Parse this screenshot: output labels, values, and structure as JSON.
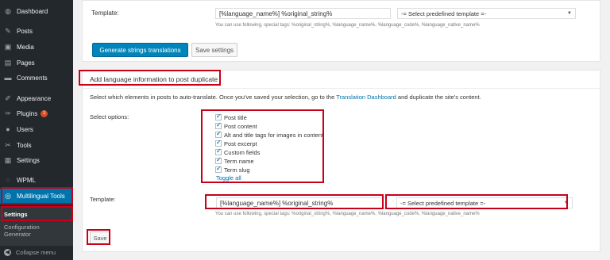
{
  "sidebar": {
    "items": [
      {
        "label": "Dashboard",
        "icon": "dashboard-icon",
        "glyph": "◍"
      },
      {
        "label": "Posts",
        "icon": "pin-icon",
        "glyph": "✎"
      },
      {
        "label": "Media",
        "icon": "media-icon",
        "glyph": "▣"
      },
      {
        "label": "Pages",
        "icon": "pages-icon",
        "glyph": "▤"
      },
      {
        "label": "Comments",
        "icon": "comment-icon",
        "glyph": "▬"
      },
      {
        "label": "Appearance",
        "icon": "brush-icon",
        "glyph": "✐"
      },
      {
        "label": "Plugins",
        "icon": "plugin-icon",
        "glyph": "✑",
        "badge": "1"
      },
      {
        "label": "Users",
        "icon": "users-icon",
        "glyph": "●"
      },
      {
        "label": "Tools",
        "icon": "wrench-icon",
        "glyph": "✂"
      },
      {
        "label": "Settings",
        "icon": "settings-icon",
        "glyph": "▦"
      },
      {
        "label": "WPML",
        "icon": "wpml-icon",
        "glyph": "◌"
      },
      {
        "label": "Multilingual Tools",
        "icon": "multilingual-tools-icon",
        "glyph": "◎"
      }
    ],
    "submenu": {
      "settings": "Settings",
      "config_generator_line1": "Configuration",
      "config_generator_line2": "Generator"
    },
    "collapse": "Collapse menu"
  },
  "top_section": {
    "template_label": "Template:",
    "template_value": "[%language_name%] %original_string%",
    "predefined_select": "-= Select predefined template =-",
    "hint": "You can use following, special tags: %original_string%, %language_name%, %language_code%, %language_native_name%",
    "generate_button": "Generate strings translations",
    "save_settings_button": "Save settings"
  },
  "duplicate_section": {
    "title": "Add language information to post duplicate",
    "description_before": "Select which elements in posts to auto-translate. Once you've saved your selection, go to the ",
    "description_link": "Translation Dashboard",
    "description_after": " and duplicate the site's content.",
    "options_label": "Select options:",
    "options": [
      {
        "label": "Post title",
        "checked": true
      },
      {
        "label": "Post content",
        "checked": true
      },
      {
        "label": "Alt and title tags for images in content",
        "checked": true
      },
      {
        "label": "Post excerpt",
        "checked": true
      },
      {
        "label": "Custom fields",
        "checked": true
      },
      {
        "label": "Term name",
        "checked": true
      },
      {
        "label": "Term slug",
        "checked": true
      }
    ],
    "toggle_all": "Toggle all",
    "template_label": "Template:",
    "template_value": "[%language_name%] %original_string%",
    "predefined_select": "-= Select predefined template =-",
    "hint": "You can use following, special tags: %original_string%, %language_name%, %language_code%, %language_native_name%",
    "save_button": "Save"
  },
  "colors": {
    "sidebar_bg": "#23282d",
    "active_menu": "#0073aa",
    "highlight": "#c9001a",
    "primary_button": "#0085ba"
  }
}
